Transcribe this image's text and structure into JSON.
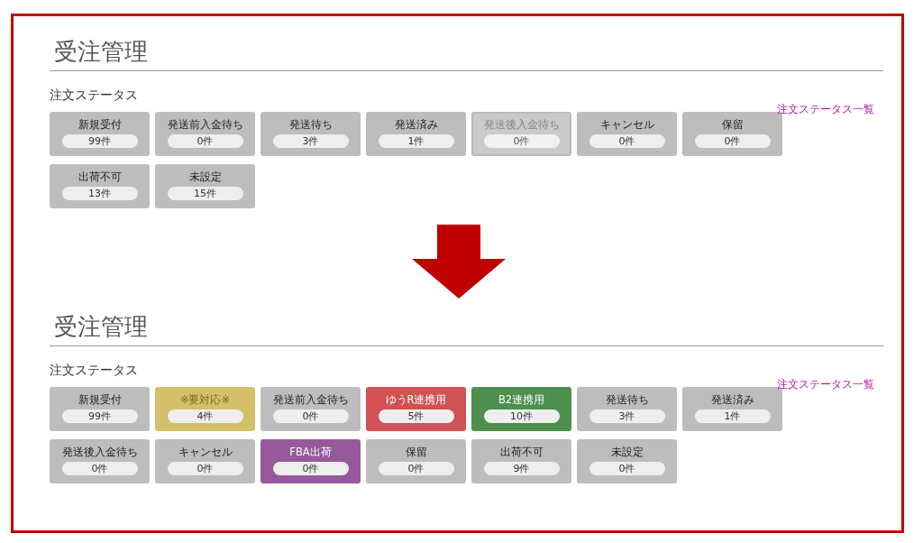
{
  "panels": [
    {
      "title": "受注管理",
      "subtitle": "注文ステータス",
      "link": "注文ステータス一覧",
      "tiles": [
        {
          "label": "新規受付",
          "count": "99件",
          "color": "#bdbdbd",
          "selected": false
        },
        {
          "label": "発送前入金待ち",
          "count": "0件",
          "color": "#bdbdbd",
          "selected": false
        },
        {
          "label": "発送待ち",
          "count": "3件",
          "color": "#bdbdbd",
          "selected": false
        },
        {
          "label": "発送済み",
          "count": "1件",
          "color": "#bdbdbd",
          "selected": false
        },
        {
          "label": "発送後入金待ち",
          "count": "0件",
          "color": "#bdbdbd",
          "selected": true
        },
        {
          "label": "キャンセル",
          "count": "0件",
          "color": "#bdbdbd",
          "selected": false
        },
        {
          "label": "保留",
          "count": "0件",
          "color": "#bdbdbd",
          "selected": false
        },
        {
          "label": "出荷不可",
          "count": "13件",
          "color": "#bdbdbd",
          "selected": false
        },
        {
          "label": "未設定",
          "count": "15件",
          "color": "#bdbdbd",
          "selected": false
        }
      ]
    },
    {
      "title": "受注管理",
      "subtitle": "注文ステータス",
      "link": "注文ステータス一覧",
      "tiles": [
        {
          "label": "新規受付",
          "count": "99件",
          "color": "#bdbdbd",
          "selected": false
        },
        {
          "label": "※要対応※",
          "count": "4件",
          "color": "#d4c068",
          "selected": false
        },
        {
          "label": "発送前入金待ち",
          "count": "0件",
          "color": "#bdbdbd",
          "selected": false
        },
        {
          "label": "ゆうR連携用",
          "count": "5件",
          "color": "#d05252",
          "selected": false
        },
        {
          "label": "B2連携用",
          "count": "10件",
          "color": "#4e8f4e",
          "selected": false
        },
        {
          "label": "発送待ち",
          "count": "3件",
          "color": "#bdbdbd",
          "selected": false
        },
        {
          "label": "発送済み",
          "count": "1件",
          "color": "#bdbdbd",
          "selected": false
        },
        {
          "label": "発送後入金待ち",
          "count": "0件",
          "color": "#bdbdbd",
          "selected": false
        },
        {
          "label": "キャンセル",
          "count": "0件",
          "color": "#bdbdbd",
          "selected": false
        },
        {
          "label": "FBA出荷",
          "count": "0件",
          "color": "#955a9a",
          "selected": false
        },
        {
          "label": "保留",
          "count": "0件",
          "color": "#bdbdbd",
          "selected": false
        },
        {
          "label": "出荷不可",
          "count": "9件",
          "color": "#bdbdbd",
          "selected": false
        },
        {
          "label": "未設定",
          "count": "0件",
          "color": "#bdbdbd",
          "selected": false
        }
      ]
    }
  ]
}
